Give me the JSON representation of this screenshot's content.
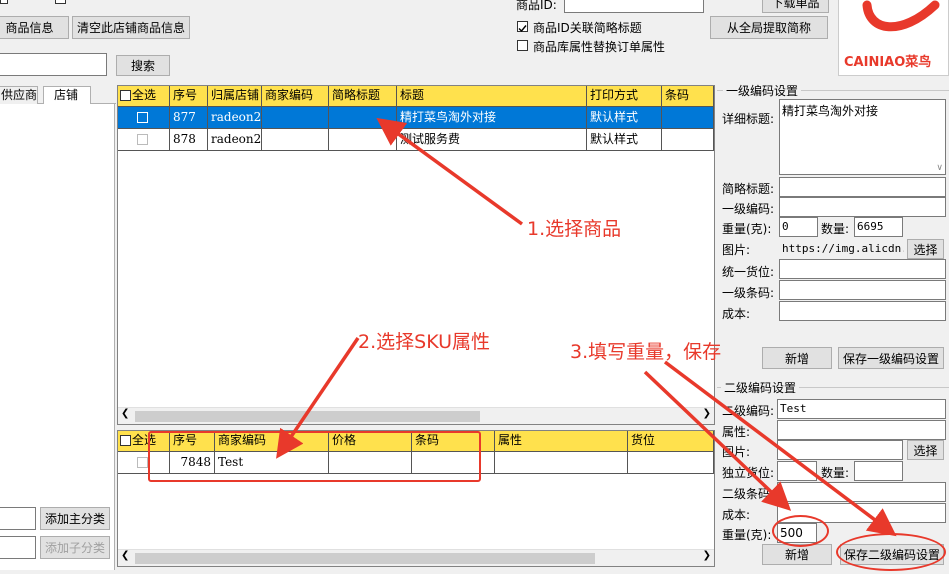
{
  "top": {
    "btn_product_info": "商品信息",
    "btn_clear_shop": "清空此店铺商品信息",
    "btn_search": "搜索",
    "product_id_label": "商品ID:",
    "btn_download": "下载单品",
    "chk_link_title": "商品ID关联简略标题",
    "chk_link_title_checked": true,
    "chk_replace_attr": "商品库属性替换订单属性",
    "chk_replace_attr_checked": false,
    "btn_extract": "从全局提取简称"
  },
  "logo": {
    "text": "CAINIAO菜鸟"
  },
  "left": {
    "tabs": [
      "供应商",
      "店铺"
    ],
    "btn_add_main": "添加主分类",
    "btn_add_sub": "添加子分类"
  },
  "products_grid": {
    "columns": [
      "全选",
      "序号",
      "归属店铺",
      "商家编码",
      "简略标题",
      "标题",
      "打印方式",
      "条码"
    ],
    "rows": [
      {
        "no": "877",
        "shop": "radeon2",
        "code": "",
        "short": "",
        "title": "精打菜鸟淘外对接",
        "print": "默认样式",
        "barcode": "",
        "selected": true
      },
      {
        "no": "878",
        "shop": "radeon2",
        "code": "",
        "short": "",
        "title": "测试服务费",
        "print": "默认样式",
        "barcode": "",
        "selected": false
      }
    ]
  },
  "sku_grid": {
    "columns": [
      "全选",
      "序号",
      "商家编码",
      "价格",
      "条码",
      "属性",
      "货位"
    ],
    "rows": [
      {
        "no": "7848",
        "code": "Test",
        "price": "",
        "barcode": "",
        "attr": "",
        "location": ""
      }
    ]
  },
  "level1": {
    "title": "一级编码设置",
    "detail_title_label": "详细标题:",
    "detail_title_value": "精打菜鸟淘外对接",
    "short_title_label": "简略标题:",
    "code_label": "一级编码:",
    "weight_label": "重量(克):",
    "weight_value": "0",
    "qty_label": "数量:",
    "qty_value": "6695",
    "image_label": "图片:",
    "image_value": "https://img.alicdn.co",
    "btn_choose": "选择",
    "location_label": "统一货位:",
    "barcode_label": "一级条码:",
    "cost_label": "成本:",
    "btn_new": "新增",
    "btn_save": "保存一级编码设置"
  },
  "level2": {
    "title": "二级编码设置",
    "code_label": "二级编码:",
    "code_value": "Test",
    "attr_label": "属性:",
    "image_label": "图片:",
    "btn_choose": "选择",
    "location_label": "独立货位:",
    "qty_label": "数量:",
    "barcode_label": "二级条码:",
    "cost_label": "成本:",
    "weight_label": "重量(克):",
    "weight_value": "500",
    "btn_new": "新增",
    "btn_save": "保存二级编码设置"
  },
  "annotations": {
    "step1": "1.选择商品",
    "step2": "2.选择SKU属性",
    "step3": "3.填写重量，保存"
  },
  "colors": {
    "header": "#ffe14d",
    "selection": "#0078d7",
    "annotation": "#e8392b"
  }
}
